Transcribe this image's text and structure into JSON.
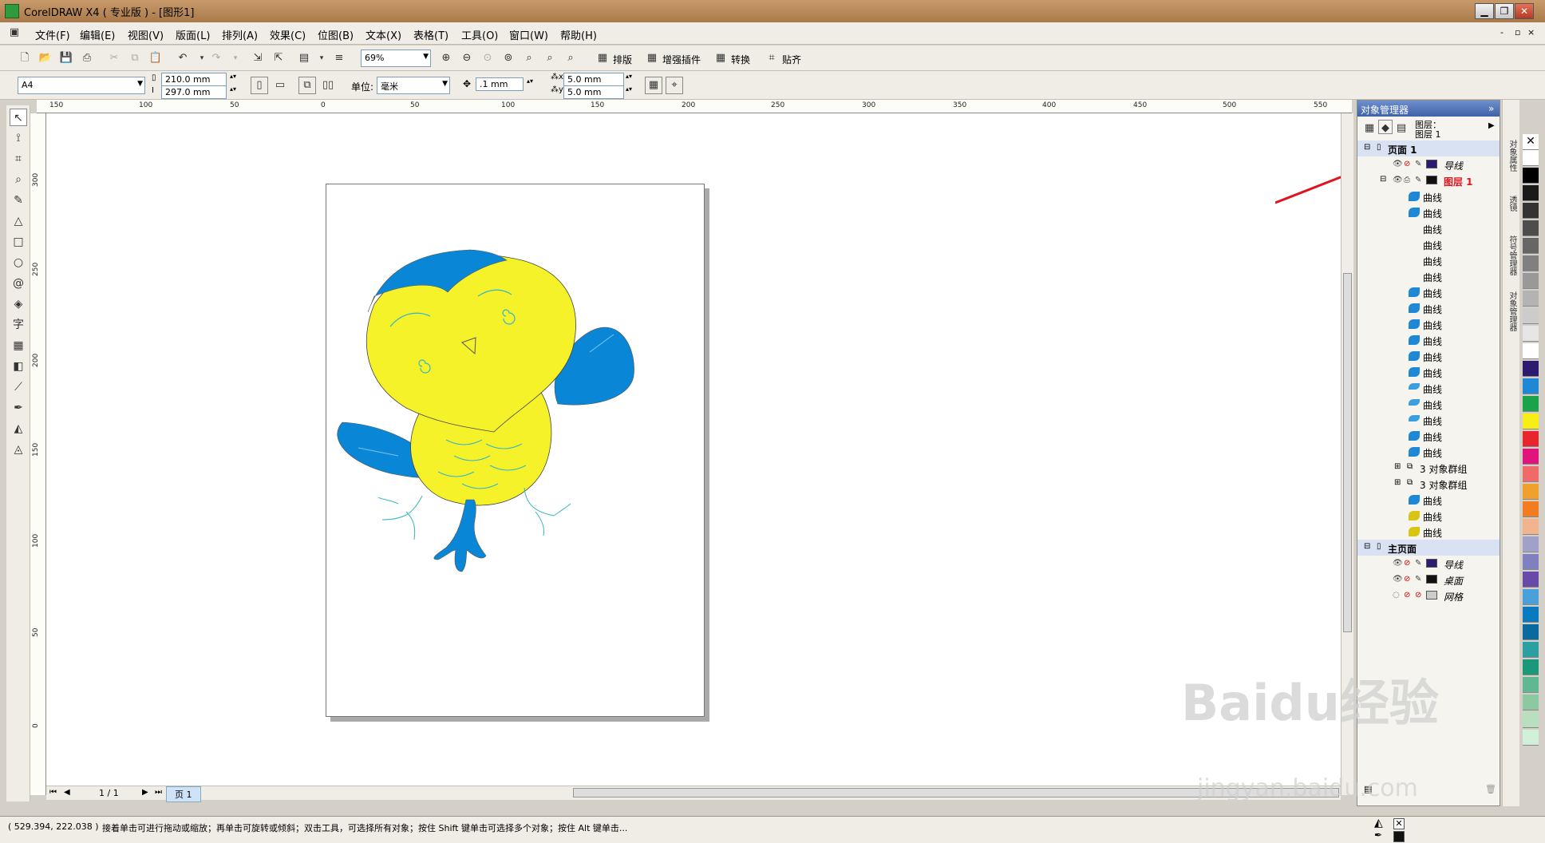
{
  "window": {
    "title": "CorelDRAW X4 ( 专业版 ) - [图形1]"
  },
  "menu": [
    {
      "label": "文件(F)"
    },
    {
      "label": "编辑(E)"
    },
    {
      "label": "视图(V)"
    },
    {
      "label": "版面(L)"
    },
    {
      "label": "排列(A)"
    },
    {
      "label": "效果(C)"
    },
    {
      "label": "位图(B)"
    },
    {
      "label": "文本(X)"
    },
    {
      "label": "表格(T)"
    },
    {
      "label": "工具(O)"
    },
    {
      "label": "窗口(W)"
    },
    {
      "label": "帮助(H)"
    }
  ],
  "toolbar": {
    "zoom": "69%",
    "btn_layout": "排版",
    "btn_plugins": "增强插件",
    "btn_convert": "转换",
    "btn_snap": "贴齐"
  },
  "propbar": {
    "page_size": "A4",
    "width": "210.0 mm",
    "height": "297.0 mm",
    "unit_label": "单位:",
    "unit_value": "毫米",
    "nudge": ".1 mm",
    "dup_x": "5.0 mm",
    "dup_y": "5.0 mm"
  },
  "ruler": {
    "h_ticks": [
      "150",
      "100",
      "50",
      "0",
      "50",
      "100",
      "150",
      "200",
      "250",
      "300",
      "350",
      "400",
      "450",
      "500",
      "550"
    ],
    "v_ticks": [
      "300",
      "250",
      "200",
      "150",
      "100",
      "50",
      "0"
    ]
  },
  "bottom": {
    "page_count": "1 / 1",
    "page_tab": "页 1"
  },
  "object_manager": {
    "title": "对象管理器",
    "layer_header": "图层：",
    "layer_header_value": "图层 1",
    "page1": "页面 1",
    "guides": "导线",
    "layer1": "图层 1",
    "items": [
      "曲线",
      "曲线",
      "曲线",
      "曲线",
      "曲线",
      "曲线",
      "曲线",
      "曲线",
      "曲线",
      "曲线",
      "曲线",
      "曲线",
      "曲线",
      "曲线",
      "曲线",
      "曲线",
      "3 对象群组",
      "3 对象群组",
      "曲线",
      "曲线",
      "曲线"
    ],
    "master": "主页面",
    "master_items": [
      "导线",
      "桌面",
      "网格"
    ]
  },
  "side_tabs": [
    "对象属性",
    "透镜",
    "符号管理器",
    "对象管理器"
  ],
  "palette_colors": [
    "#ffffff",
    "#000000",
    "#1a1a1a",
    "#333333",
    "#4d4d4d",
    "#666666",
    "#808080",
    "#999999",
    "#b3b3b3",
    "#cccccc",
    "#e6e6e6",
    "#ffffff",
    "#2e1a6e",
    "#1e88d6",
    "#1aa34a",
    "#f6ee14",
    "#e8242c",
    "#e0147c",
    "#f06a6a",
    "#f0a02c",
    "#f47c20",
    "#f2b48c",
    "#a0a0c8",
    "#8080c0",
    "#6a4aa8",
    "#4aa0d8",
    "#0a7ac0",
    "#0a6aa0",
    "#2aa0a0",
    "#1a9878",
    "#60b890",
    "#8cc8a0",
    "#b8e0c0",
    "#d0f0d8"
  ],
  "status": {
    "coords": "( 529.394, 222.038 )",
    "hint": "接着单击可进行拖动或缩放；再单击可旋转或倾斜；双击工具，可选择所有对象；按住 Shift 键单击可选择多个对象；按住 Alt 键单击..."
  },
  "watermark": {
    "brand": "Baidu经验",
    "url": "jingyan.baidu.com"
  }
}
